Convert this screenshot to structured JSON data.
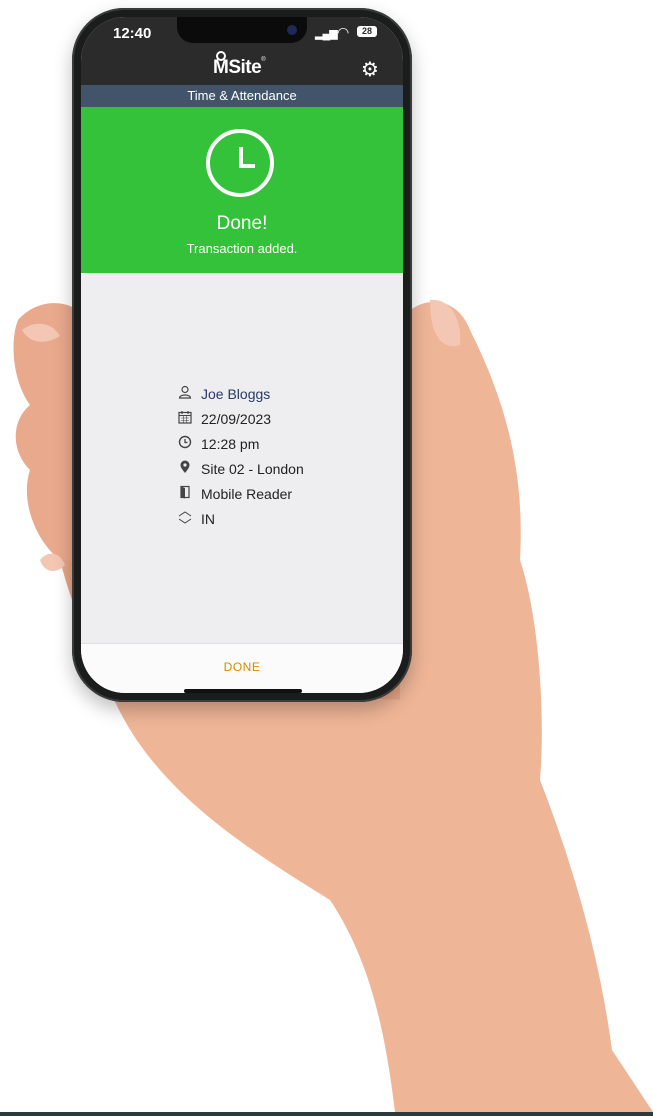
{
  "status_bar": {
    "time": "12:40",
    "signal": "▂▄▆",
    "wifi": "◠",
    "battery": "28"
  },
  "app_bar": {
    "logo_text": "MSite",
    "logo_reg": "®",
    "settings_icon": "gear-icon"
  },
  "subheader": {
    "title": "Time & Attendance"
  },
  "banner": {
    "title": "Done!",
    "message": "Transaction added.",
    "color": "#35c23b"
  },
  "details": {
    "user": {
      "icon": "user-icon",
      "value": "Joe Bloggs"
    },
    "date": {
      "icon": "calendar-icon",
      "value": "22/09/2023"
    },
    "time": {
      "icon": "clock-icon",
      "value": "12:28 pm"
    },
    "site": {
      "icon": "location-icon",
      "value": "Site 02 - London"
    },
    "reader": {
      "icon": "door-icon",
      "value": "Mobile Reader"
    },
    "direction": {
      "icon": "direction-icon",
      "value": "IN"
    }
  },
  "footer": {
    "done_label": "DONE",
    "accent": "#d88a00"
  }
}
